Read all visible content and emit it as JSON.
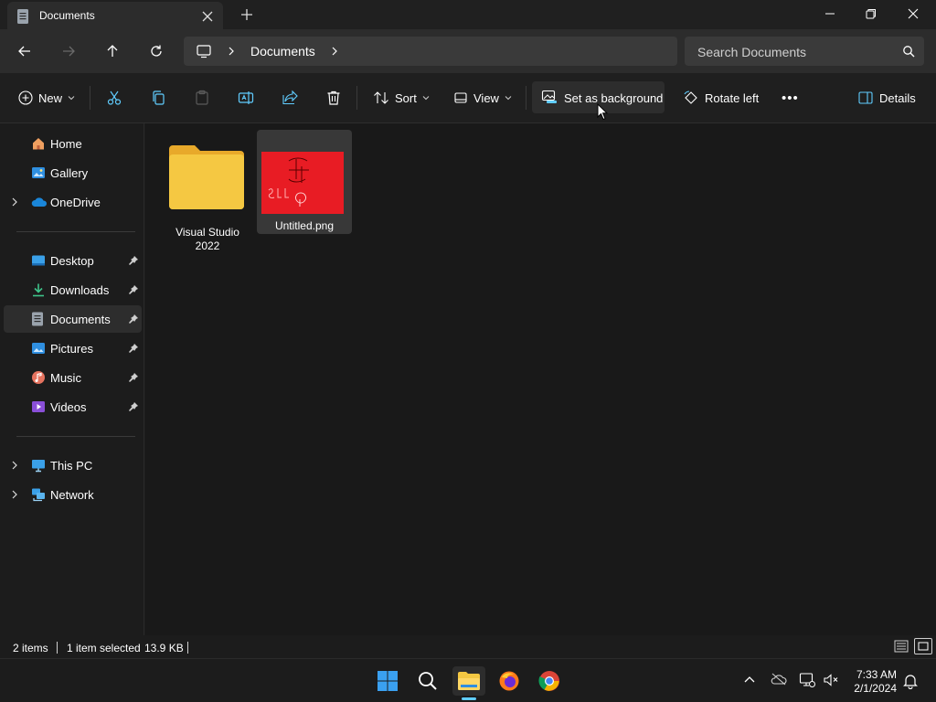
{
  "window": {
    "tab_title": "Documents",
    "new_tab_symbol": "+"
  },
  "address": {
    "path": "Documents",
    "search_placeholder": "Search Documents"
  },
  "commands": {
    "new": "New",
    "sort": "Sort",
    "view": "View",
    "set_background": "Set as background",
    "rotate_left": "Rotate left",
    "more": "•••",
    "details": "Details"
  },
  "sidebar": {
    "quick": [
      {
        "label": "Home"
      },
      {
        "label": "Gallery"
      },
      {
        "label": "OneDrive"
      }
    ],
    "pinned": [
      {
        "label": "Desktop"
      },
      {
        "label": "Downloads"
      },
      {
        "label": "Documents"
      },
      {
        "label": "Pictures"
      },
      {
        "label": "Music"
      },
      {
        "label": "Videos"
      }
    ],
    "devices": [
      {
        "label": "This PC"
      },
      {
        "label": "Network"
      }
    ]
  },
  "files": [
    {
      "name_line1": "Visual Studio",
      "name_line2": "2022",
      "type": "folder"
    },
    {
      "name": "Untitled.png",
      "type": "image"
    }
  ],
  "status": {
    "count": "2 items",
    "selection": "1 item selected",
    "size": "13.9 KB"
  },
  "clock": {
    "time": "7:33 AM",
    "date": "2/1/2024"
  },
  "colors": {
    "accent": "#60cdff",
    "folder": "#f5c842",
    "thumbnail_bg": "#e81c24"
  }
}
